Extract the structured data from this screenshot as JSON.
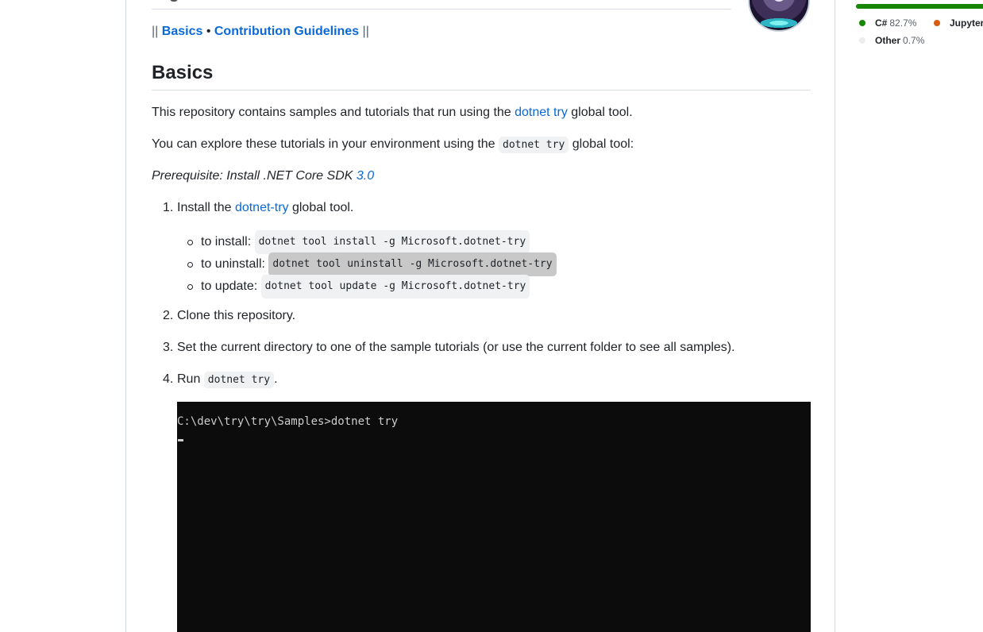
{
  "readme": {
    "nav": {
      "sep_open": "||",
      "link_basics": "Basics",
      "bullet": "•",
      "link_contrib": "Contribution Guidelines",
      "sep_close": "||"
    },
    "heading": "Basics",
    "intro": {
      "pre": "This repository contains samples and tutorials that run using the ",
      "link": "dotnet try",
      "post": " global tool."
    },
    "explore": {
      "pre": "You can explore these tutorials in your environment using the ",
      "code": "dotnet try",
      "post": " global tool:"
    },
    "prereq": {
      "pre": "Prerequisite: Install .NET Core SDK ",
      "link": "3.0"
    },
    "steps": [
      {
        "num": "1.",
        "pre": "Install the ",
        "link": "dotnet-try",
        "post": " global tool."
      },
      {
        "num": "2.",
        "text": "Clone this repository."
      },
      {
        "num": "3.",
        "text": "Set the current directory to one of the sample tutorials (or use the current folder to see all samples)."
      },
      {
        "num": "4.",
        "pre": "Run ",
        "code": "dotnet try",
        "post": "."
      }
    ],
    "substeps": [
      {
        "label": "to install:",
        "code": "dotnet tool install -g Microsoft.dotnet-try"
      },
      {
        "label": "to uninstall:",
        "code": "dotnet tool uninstall -g Microsoft.dotnet-try"
      },
      {
        "label": "to update:",
        "code": "dotnet tool update -g Microsoft.dotnet-try"
      }
    ],
    "terminal": {
      "line": "C:\\dev\\try\\try\\Samples>dotnet try"
    }
  },
  "languages": {
    "bar_color": "#178600",
    "items": [
      {
        "name": "C#",
        "pct": "82.7%",
        "color": "#178600"
      },
      {
        "name": "Jupyter",
        "pct": "",
        "color": "#DA5B0B"
      },
      {
        "name": "Other",
        "pct": "0.7%",
        "color": "#ededed"
      }
    ]
  }
}
